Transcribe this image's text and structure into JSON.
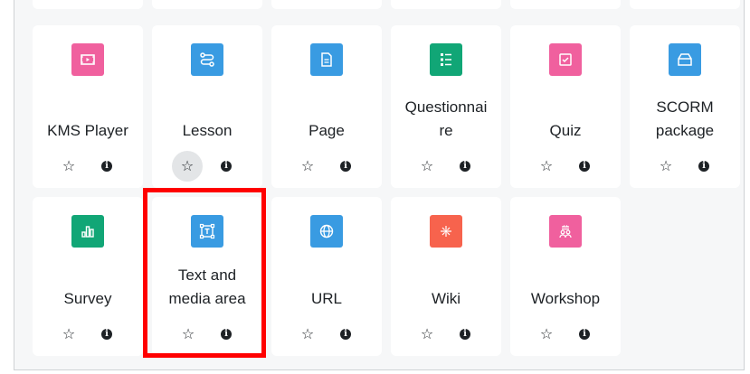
{
  "colors": {
    "pink": "#f0609e",
    "blue": "#399be2",
    "green": "#11a676",
    "orange": "#f7634d",
    "highlight": "#ff0000"
  },
  "activities": {
    "row1": [
      {
        "label": "KMS Player",
        "icon": "video-player-icon",
        "color": "pink"
      },
      {
        "label": "Lesson",
        "icon": "lesson-path-icon",
        "color": "blue"
      },
      {
        "label": "Page",
        "icon": "page-document-icon",
        "color": "blue"
      },
      {
        "label": "Questionnaire",
        "icon": "questionnaire-list-icon",
        "color": "green"
      },
      {
        "label": "Quiz",
        "icon": "quiz-check-icon",
        "color": "pink"
      },
      {
        "label": "SCORM package",
        "icon": "scorm-box-icon",
        "color": "blue"
      }
    ],
    "row2": [
      {
        "label": "Survey",
        "icon": "survey-bar-chart-icon",
        "color": "green"
      },
      {
        "label": "Text and media area",
        "icon": "text-media-area-icon",
        "color": "blue"
      },
      {
        "label": "URL",
        "icon": "globe-icon",
        "color": "blue"
      },
      {
        "label": "Wiki",
        "icon": "wiki-network-icon",
        "color": "orange"
      },
      {
        "label": "Workshop",
        "icon": "workshop-people-icon",
        "color": "pink"
      }
    ]
  },
  "labels_display": {
    "questionnaire": [
      "Questionnai",
      "re"
    ],
    "scorm": [
      "SCORM",
      "package"
    ],
    "text_media": [
      "Text and",
      "media area"
    ]
  }
}
